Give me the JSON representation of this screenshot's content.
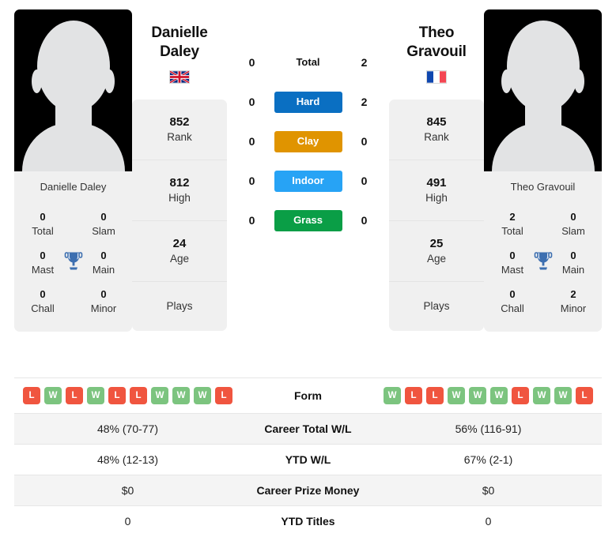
{
  "colors": {
    "hard": "#0a6fc2",
    "clay": "#e09400",
    "indoor": "#27a3f5",
    "grass": "#0a9e46",
    "win": "#7cc47f",
    "loss": "#f0553f",
    "trophy": "#3d6fb0",
    "panel": "#f0f0f0"
  },
  "players": {
    "left": {
      "first_name": "Danielle",
      "last_name": "Daley",
      "full_name": "Danielle Daley",
      "flag": "gb",
      "flag_name": "united-kingdom-flag",
      "avatar_name": "player-photo-placeholder",
      "rank": "852",
      "rank_label": "Rank",
      "high": "812",
      "high_label": "High",
      "age": "24",
      "age_label": "Age",
      "plays": "",
      "plays_label": "Plays",
      "honors": [
        {
          "value": "0",
          "label": "Total"
        },
        {
          "value": "0",
          "label": "Slam"
        },
        {
          "value": "0",
          "label": "Mast"
        },
        {
          "value": "0",
          "label": "Main"
        },
        {
          "value": "0",
          "label": "Chall"
        },
        {
          "value": "0",
          "label": "Minor"
        }
      ],
      "form": [
        "L",
        "W",
        "L",
        "W",
        "L",
        "L",
        "W",
        "W",
        "W",
        "L"
      ],
      "career_wl": "48% (70-77)",
      "ytd_wl": "48% (12-13)",
      "prize_money": "$0",
      "ytd_titles": "0"
    },
    "right": {
      "first_name": "Theo",
      "last_name": "Gravouil",
      "full_name": "Theo Gravouil",
      "flag": "fr",
      "flag_name": "france-flag",
      "avatar_name": "player-photo-placeholder",
      "rank": "845",
      "rank_label": "Rank",
      "high": "491",
      "high_label": "High",
      "age": "25",
      "age_label": "Age",
      "plays": "",
      "plays_label": "Plays",
      "honors": [
        {
          "value": "2",
          "label": "Total"
        },
        {
          "value": "0",
          "label": "Slam"
        },
        {
          "value": "0",
          "label": "Mast"
        },
        {
          "value": "0",
          "label": "Main"
        },
        {
          "value": "0",
          "label": "Chall"
        },
        {
          "value": "2",
          "label": "Minor"
        }
      ],
      "form": [
        "W",
        "L",
        "L",
        "W",
        "W",
        "W",
        "L",
        "W",
        "W",
        "L"
      ],
      "career_wl": "56% (116-91)",
      "ytd_wl": "67% (2-1)",
      "prize_money": "$0",
      "ytd_titles": "0"
    }
  },
  "surfaces": [
    {
      "label": "Total",
      "left": "0",
      "right": "2",
      "style": "plain"
    },
    {
      "label": "Hard",
      "left": "0",
      "right": "2",
      "style": "hard"
    },
    {
      "label": "Clay",
      "left": "0",
      "right": "0",
      "style": "clay"
    },
    {
      "label": "Indoor",
      "left": "0",
      "right": "0",
      "style": "indoor"
    },
    {
      "label": "Grass",
      "left": "0",
      "right": "0",
      "style": "grass"
    }
  ],
  "table": {
    "form_label": "Form",
    "rows": [
      {
        "label": "Career Total W/L",
        "left": "48% (70-77)",
        "right": "56% (116-91)"
      },
      {
        "label": "YTD W/L",
        "left": "48% (12-13)",
        "right": "67% (2-1)"
      },
      {
        "label": "Career Prize Money",
        "left": "$0",
        "right": "$0"
      },
      {
        "label": "YTD Titles",
        "left": "0",
        "right": "0"
      }
    ]
  }
}
